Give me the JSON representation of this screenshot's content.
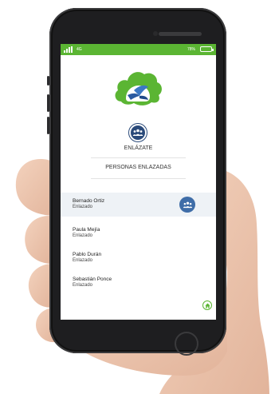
{
  "statusbar": {
    "carrier": "4G",
    "battery_percent": "78%"
  },
  "app": {
    "title": "ENLÁZATE",
    "subtitle": "PERSONAS ENLAZADAS"
  },
  "contacts": [
    {
      "name": "Bernado Ortiz",
      "status": "Enlazado",
      "highlighted": true
    },
    {
      "name": "Paula Mejía",
      "status": "Enlazado"
    },
    {
      "name": "Pablo Durán",
      "status": "Enlazado"
    },
    {
      "name": "Sebastián Ponce",
      "status": "Enlazado"
    }
  ],
  "icons": {
    "logo": "cloud-bird-logo-icon",
    "link": "people-group-icon",
    "home": "home-icon"
  },
  "colors": {
    "accent_green": "#5bb533",
    "navy": "#2a4a7a",
    "badge_blue": "#3f6da8"
  }
}
